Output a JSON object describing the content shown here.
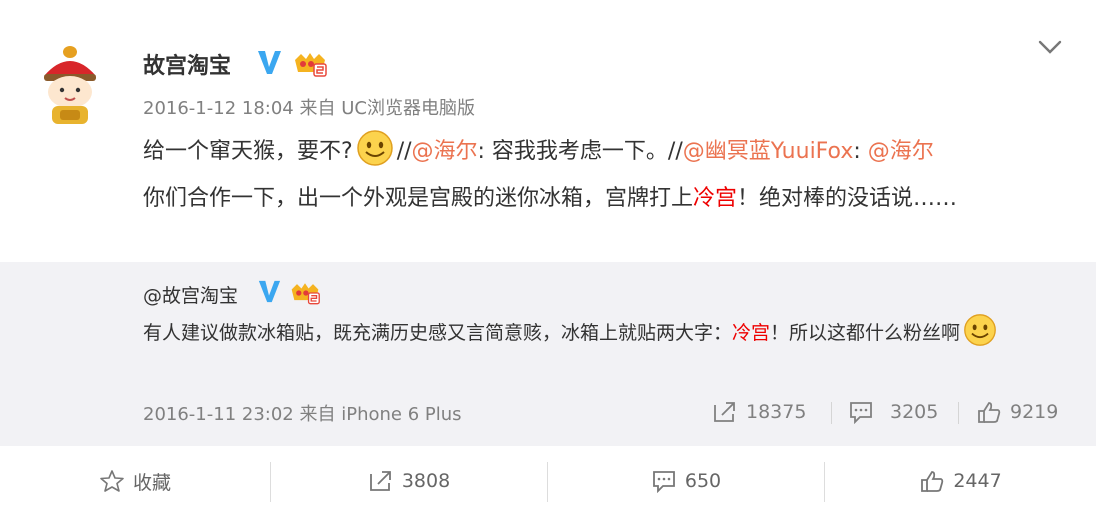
{
  "post": {
    "author": "故宫淘宝",
    "timestamp": "2016-1-12 18:04",
    "source_prefix": "来自",
    "source": "UC浏览器电脑版",
    "text_1": "给一个窜天猴，要不?",
    "text_2": "//",
    "mention_1": "@海尔",
    "text_3": ": 容我我考虑一下。//",
    "mention_2": "@幽冥蓝YuuiFox",
    "text_4": ": ",
    "mention_3": "@海尔",
    "text_5": "你们合作一下，出一个外观是宫殿的迷你冰箱，宫牌打上",
    "highlight": "冷宫",
    "text_6": "！绝对棒的没话说……"
  },
  "repost": {
    "author": "@故宫淘宝",
    "text_1": "有人建议做款冰箱贴，既充满历史感又言简意赅，冰箱上就贴两大字：",
    "highlight": "冷宫",
    "text_2": "！所以这都什么粉丝啊",
    "timestamp": "2016-1-11 23:02",
    "source_prefix": "来自",
    "source": "iPhone 6 Plus",
    "reposts": "18375",
    "comments": "3205",
    "likes": "9219"
  },
  "actions": {
    "favorite": "收藏",
    "reposts": "3808",
    "comments": "650",
    "likes": "2447"
  },
  "colors": {
    "mention": "#eb7350",
    "highlight": "#ee0000",
    "verified": "#3ba7f0",
    "repost_bg": "#f2f2f5"
  }
}
